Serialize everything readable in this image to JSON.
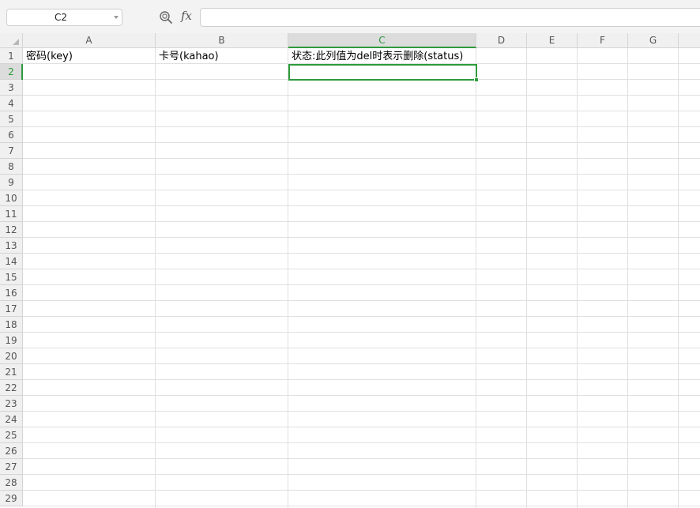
{
  "name_box": {
    "value": "C2"
  },
  "formula_bar": {
    "fx_label": "fx",
    "value": ""
  },
  "columns": [
    "A",
    "B",
    "C",
    "D",
    "E",
    "F",
    "G"
  ],
  "rows": [
    "1",
    "2",
    "3",
    "4",
    "5",
    "6",
    "7",
    "8",
    "9",
    "10",
    "11",
    "12",
    "13",
    "14",
    "15",
    "16",
    "17",
    "18",
    "19",
    "20",
    "21",
    "22",
    "23",
    "24",
    "25",
    "26",
    "27",
    "28",
    "29"
  ],
  "cells": {
    "A1": "密码(key)",
    "B1": "卡号(kahao)",
    "C1": "状态:此列值为del时表示删除(status)"
  },
  "selection": {
    "active_cell": "C2",
    "active_column": "C",
    "active_row": "2"
  },
  "colors": {
    "accent": "#2e9a3c",
    "header_bg": "#f0f0f0",
    "gridline": "#e0e0e0"
  },
  "icons": {
    "zoom": "zoom-icon",
    "corner": "select-all-triangle-icon"
  }
}
